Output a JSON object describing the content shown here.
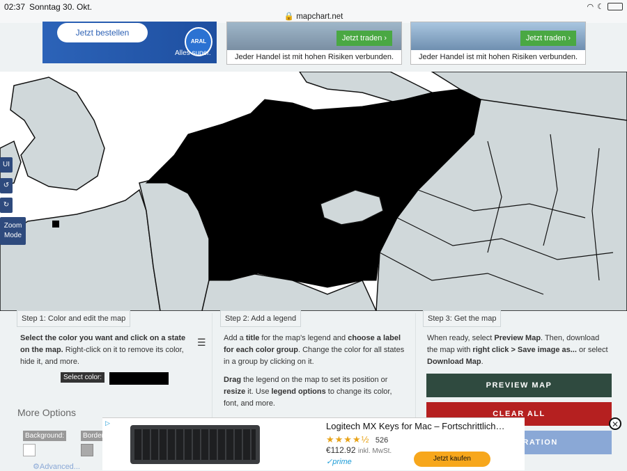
{
  "status_bar": {
    "time": "02:37",
    "date": "Sonntag 30. Okt.",
    "url": "mapchart.net"
  },
  "ads": {
    "aral": {
      "button": "Jetzt bestellen",
      "logo": "ARAL",
      "slogan": "Alles super."
    },
    "trade1": {
      "button": "Jetzt traden ›",
      "risk": "Jeder Handel ist mit hohen Risiken verbunden."
    },
    "trade2": {
      "button": "Jetzt traden ›",
      "risk": "Jeder Handel ist mit hohen Risiken verbunden."
    }
  },
  "side": {
    "ui": "UI",
    "zoom": "Zoom Mode"
  },
  "step1": {
    "title": "Step 1: Color and edit the map",
    "bold1": "Select the color you want and click on a state on the map.",
    "text1": " Right-click on it to remove its color, hide it, and more.",
    "select_color_label": "Select color:",
    "selected_color": "#000000"
  },
  "step2": {
    "title": "Step 2: Add a legend",
    "p1a": "Add a ",
    "p1b": "title",
    "p1c": " for the map's legend and ",
    "p1d": "choose a label for each color group",
    "p1e": ". Change the color for all states in a group by clicking on it.",
    "p2a": "Drag",
    "p2b": " the legend on the map to set its position or ",
    "p2c": "resize",
    "p2d": " it. Use ",
    "p2e": "legend options",
    "p2f": " to change its color, font, and more."
  },
  "step3": {
    "title": "Step 3: Get the map",
    "p1a": "When ready, select ",
    "p1b": "Preview Map",
    "p1c": ". Then, download the map with ",
    "p1d": "right click > Save image as...",
    "p1e": " or select ",
    "p1f": "Download Map",
    "p1g": ".",
    "preview_button": "PREVIEW MAP",
    "clear_button": "CLEAR ALL",
    "config_button": "CONFIGURATION"
  },
  "more_options": {
    "title": "More Options",
    "background": "Background:",
    "borders": "Borders",
    "advanced": "Advanced..."
  },
  "bottom_ad": {
    "title": "Logitech MX Keys for Mac – Fortschrittlich…",
    "stars": "★★★★½",
    "reviews": "526",
    "price": "€112.92",
    "price_note": "inkl. MwSt.",
    "prime": "prime",
    "buy": "Jetzt kaufen"
  },
  "colors": {
    "accent_dark": "#2f4a3f",
    "clear_red": "#b52020",
    "config_blue": "#8aa8d6",
    "selected": "#000000"
  }
}
